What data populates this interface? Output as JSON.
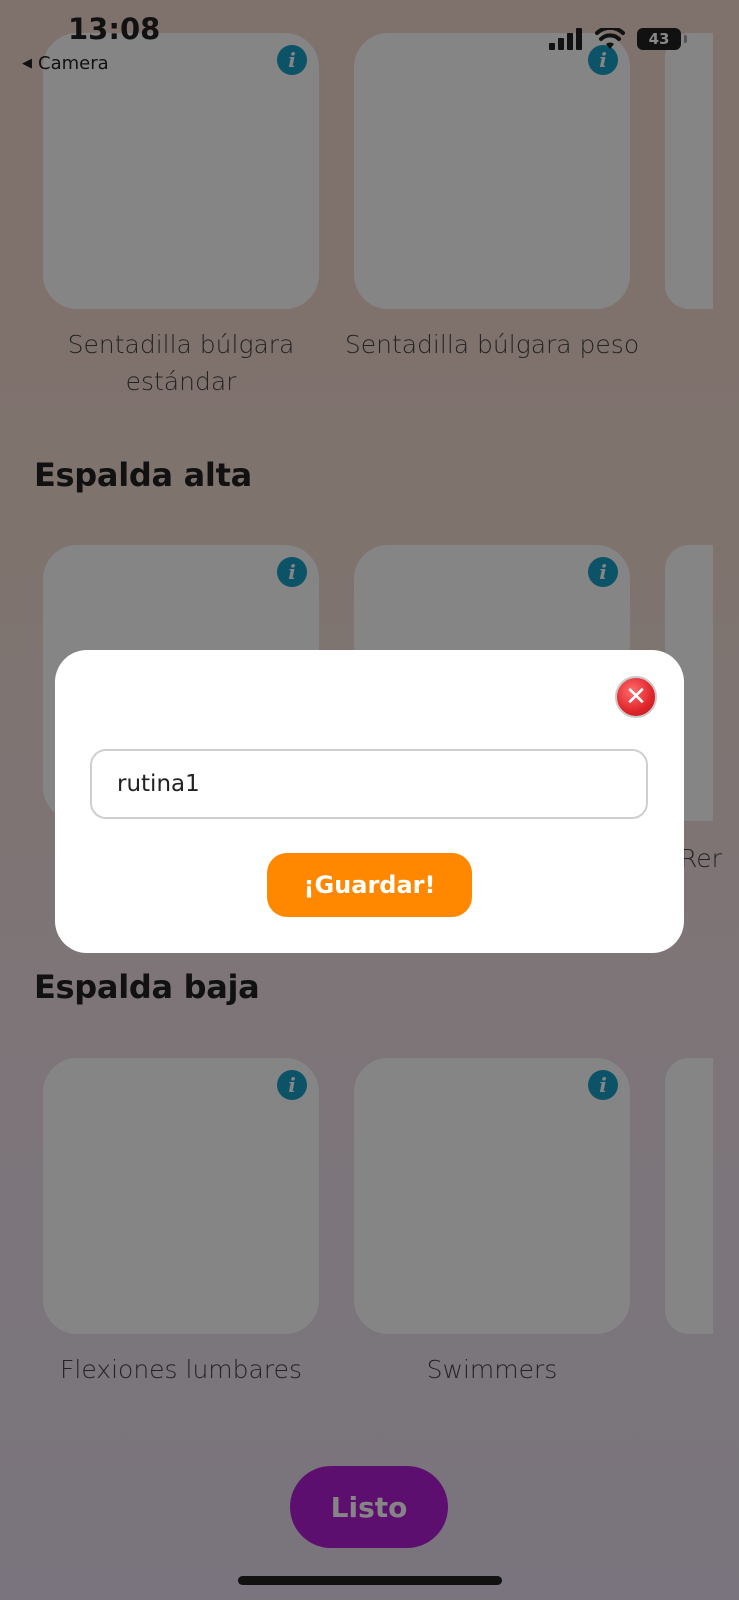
{
  "status_bar": {
    "time": "13:08",
    "back_label": "Camera",
    "battery": "43",
    "icons": [
      "signal-icon",
      "wifi-icon",
      "battery-icon"
    ]
  },
  "sections": [
    {
      "title": "",
      "cards": [
        {
          "label": "Sentadilla búlgara estándar"
        },
        {
          "label": "Sentadilla búlgara peso"
        }
      ]
    },
    {
      "title": "Espalda alta",
      "cards": [
        {
          "label": ""
        },
        {
          "label": ""
        }
      ],
      "partial_label": "Rer"
    },
    {
      "title": "Espalda baja",
      "cards": [
        {
          "label": "Flexiones lumbares"
        },
        {
          "label": "Swimmers"
        }
      ]
    }
  ],
  "done_button": "Listo",
  "modal": {
    "input_value": "rutina1",
    "save_button": "¡Guardar!"
  },
  "colors": {
    "accent_orange": "#ff8800",
    "accent_purple": "#b21ed6",
    "info_blue": "#1aa0c8",
    "close_red": "#e0242b"
  }
}
